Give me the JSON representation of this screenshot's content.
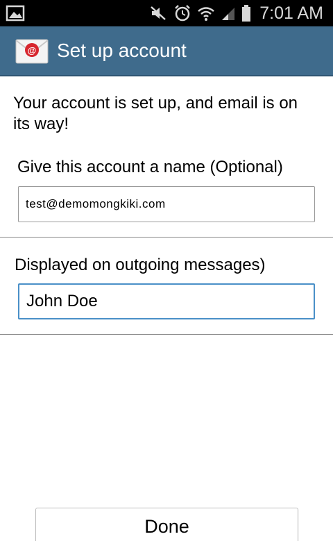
{
  "status_bar": {
    "time": "7:01 AM",
    "icons": [
      "gallery-icon",
      "mute-icon",
      "alarm-icon",
      "wifi-icon",
      "signal-icon",
      "battery-icon"
    ]
  },
  "action_bar": {
    "title": "Set up account",
    "app_icon": "email-app-icon",
    "color": "#3f6b8c"
  },
  "content": {
    "intro": "Your account is set up, and email is on its way!",
    "account_name_label": "Give this account a name (Optional)",
    "account_name_value": "test@demomongkiki.com",
    "your_name_label": "Displayed on outgoing messages)",
    "your_name_value": "John Doe"
  },
  "footer": {
    "done_label": "Done"
  }
}
